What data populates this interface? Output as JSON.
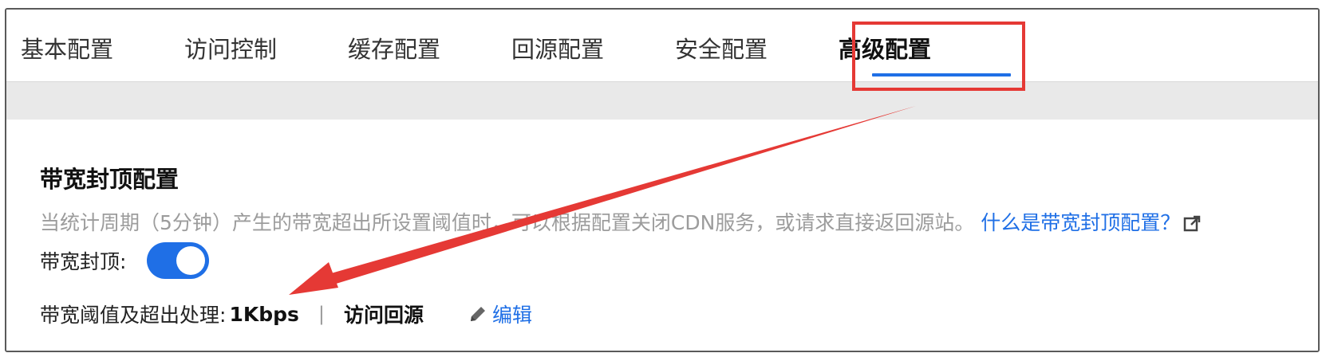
{
  "tabs": [
    {
      "label": "基本配置"
    },
    {
      "label": "访问控制"
    },
    {
      "label": "缓存配置"
    },
    {
      "label": "回源配置"
    },
    {
      "label": "安全配置"
    },
    {
      "label": "高级配置"
    }
  ],
  "active_tab": "高级配置",
  "section": {
    "title": "带宽封顶配置",
    "description": "当统计周期（5分钟）产生的带宽超出所设置阈值时，可以根据配置关闭CDN服务，或请求直接返回源站。",
    "help_link": "什么是带宽封顶配置？",
    "toggle_label": "带宽封顶:",
    "toggle_on": true,
    "threshold_label": "带宽阈值及超出处理:",
    "threshold_value": "1Kbps",
    "separator": "|",
    "exceed_action": "访问回源",
    "edit_label": "编辑"
  },
  "colors": {
    "accent": "#1f6fe6",
    "annotation": "#e53935"
  },
  "icons": [
    "external-link-icon",
    "pencil-icon"
  ]
}
